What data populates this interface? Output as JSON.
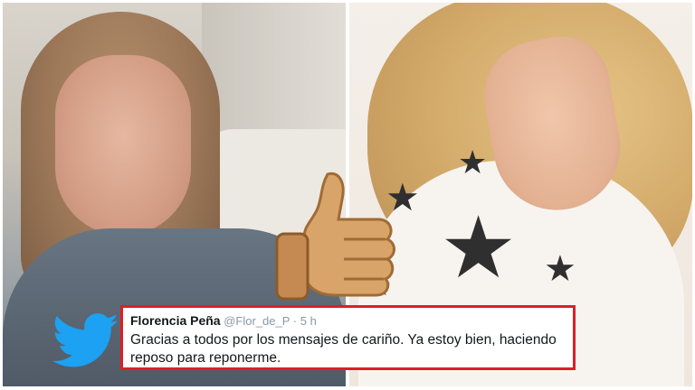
{
  "tweet": {
    "display_name": "Florencia Peña",
    "handle": "@Flor_de_P",
    "separator": "·",
    "time": "5 h",
    "text": "Gracias a todos por los mensajes de cariño. Ya estoy bien, haciendo reposo para reponerme."
  },
  "icons": {
    "brand": "twitter-bird-icon",
    "reaction": "thumbs-up-icon"
  },
  "colors": {
    "twitter_blue": "#1da1f2",
    "frame_red": "#dd1f26"
  }
}
